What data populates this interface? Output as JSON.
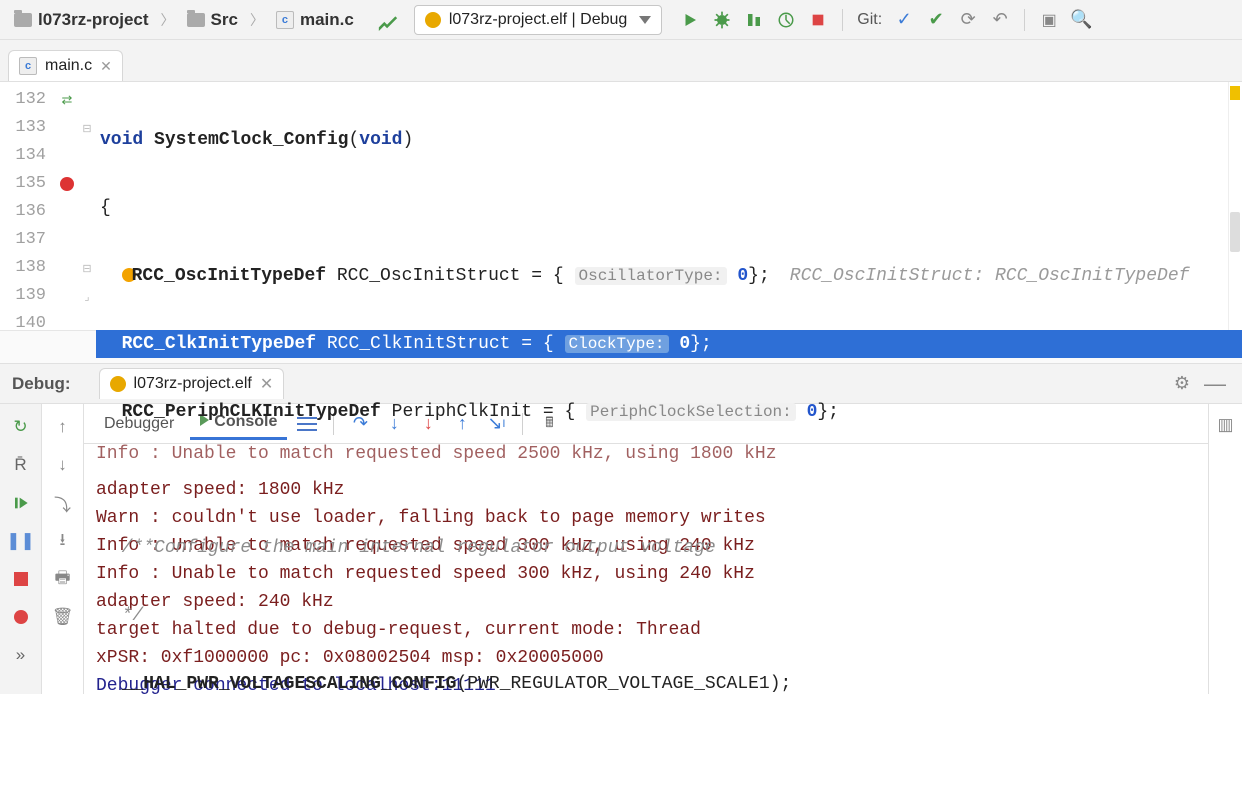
{
  "breadcrumb": {
    "project": "l073rz-project",
    "folder": "Src",
    "file": "main.c"
  },
  "run_config": {
    "label": "l073rz-project.elf | Debug"
  },
  "git_label": "Git:",
  "editor_tab": {
    "file": "main.c"
  },
  "gutter": {
    "lines": [
      "132",
      "133",
      "134",
      "135",
      "136",
      "137",
      "138",
      "139",
      "140"
    ]
  },
  "code": {
    "l132_kw1": "void",
    "l132_fn": "SystemClock_Config",
    "l132_p1": "(",
    "l132_kw2": "void",
    "l132_p2": ")",
    "l133": "{",
    "l134_ty": "RCC_OscInitTypeDef",
    "l134_var": " RCC_OscInitStruct = {",
    "l134_hint": "OscillatorType:",
    "l134_num": "0",
    "l134_tail": "};",
    "l134_trail": "RCC_OscInitStruct: RCC_OscInitTypeDef",
    "l135_ty": "RCC_ClkInitTypeDef",
    "l135_var": " RCC_ClkInitStruct = {",
    "l135_hint": "ClockType:",
    "l135_num": "0",
    "l135_tail": "};",
    "l136_ty": "RCC_PeriphCLKInitTypeDef",
    "l136_var": " PeriphClkInit = {",
    "l136_hint": "PeriphClockSelection:",
    "l136_num": "0",
    "l136_tail": "};",
    "l138": "/**Configure the main internal regulator output voltage",
    "l139": "*/",
    "l140_pre": "__",
    "l140_fn": "HAL_PWR_VOLTAGESCALING_CONFIG",
    "l140_args": "(PWR_REGULATOR_VOLTAGE_SCALE1);"
  },
  "fn_crumb": "SystemClock_Config",
  "debug": {
    "title": "Debug:",
    "tab": "l073rz-project.elf",
    "tabs": {
      "debugger": "Debugger",
      "console": "Console"
    },
    "console_lines": [
      "Info : Unable to match requested speed 2500 kHz, using 1800 kHz",
      "adapter speed: 1800 kHz",
      "Warn : couldn't use loader, falling back to page memory writes",
      "Info : Unable to match requested speed 300 kHz, using 240 kHz",
      "Info : Unable to match requested speed 300 kHz, using 240 kHz",
      "adapter speed: 240 kHz",
      "target halted due to debug-request, current mode: Thread",
      "xPSR: 0xf1000000 pc: 0x08002504 msp: 0x20005000",
      "Debugger connected to localhost:11111"
    ]
  }
}
